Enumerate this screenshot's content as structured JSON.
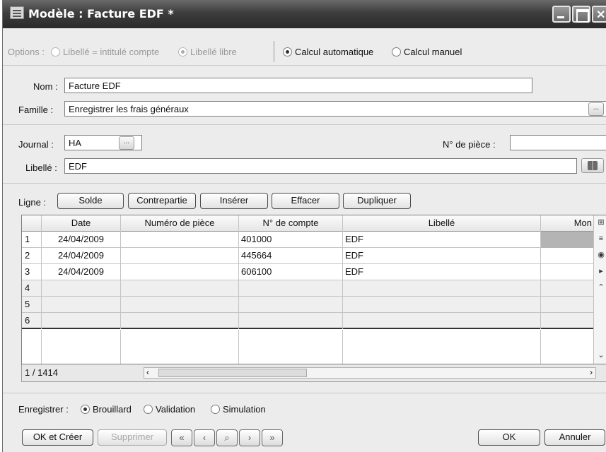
{
  "window": {
    "title": "Modèle : Facture EDF *"
  },
  "options": {
    "prefix": "Options :",
    "libelle_intitule": "Libellé = intitulé compte",
    "libelle_libre": "Libellé libre",
    "calcul_auto": "Calcul automatique",
    "calcul_manuel": "Calcul manuel",
    "selected_libelle": "Libellé libre",
    "selected_calcul": "Calcul automatique"
  },
  "form": {
    "nom_label": "Nom :",
    "nom_value": "Facture EDF",
    "famille_label": "Famille :",
    "famille_value": "Enregistrer les frais généraux",
    "journal_label": "Journal :",
    "journal_value": "HA",
    "piece_label": "N° de pièce :",
    "piece_value": "",
    "libelle_label": "Libellé :",
    "libelle_value": "EDF"
  },
  "ligne": {
    "label": "Ligne :",
    "buttons": [
      "Solde",
      "Contrepartie",
      "Insérer",
      "Effacer",
      "Dupliquer"
    ]
  },
  "grid": {
    "columns": [
      "Date",
      "Numéro de pièce",
      "N° de compte",
      "Libellé",
      "Mon"
    ],
    "rows": [
      {
        "num": "1",
        "date": "24/04/2009",
        "piece": "",
        "compte": "401000",
        "libelle": "EDF",
        "montant": ""
      },
      {
        "num": "2",
        "date": "24/04/2009",
        "piece": "",
        "compte": "445664",
        "libelle": "EDF",
        "montant": ""
      },
      {
        "num": "3",
        "date": "24/04/2009",
        "piece": "",
        "compte": "606100",
        "libelle": "EDF",
        "montant": ""
      },
      {
        "num": "4",
        "date": "",
        "piece": "",
        "compte": "",
        "libelle": "",
        "montant": ""
      },
      {
        "num": "5",
        "date": "",
        "piece": "",
        "compte": "",
        "libelle": "",
        "montant": ""
      },
      {
        "num": "6",
        "date": "",
        "piece": "",
        "compte": "",
        "libelle": "",
        "montant": ""
      }
    ],
    "status": "1 / 1414"
  },
  "enregistrer": {
    "label": "Enregistrer :",
    "brouillard": "Brouillard",
    "validation": "Validation",
    "simulation": "Simulation",
    "selected": "Brouillard"
  },
  "footer": {
    "ok_creer": "OK et Créer",
    "supprimer": "Supprimer",
    "ok": "OK",
    "annuler": "Annuler"
  }
}
